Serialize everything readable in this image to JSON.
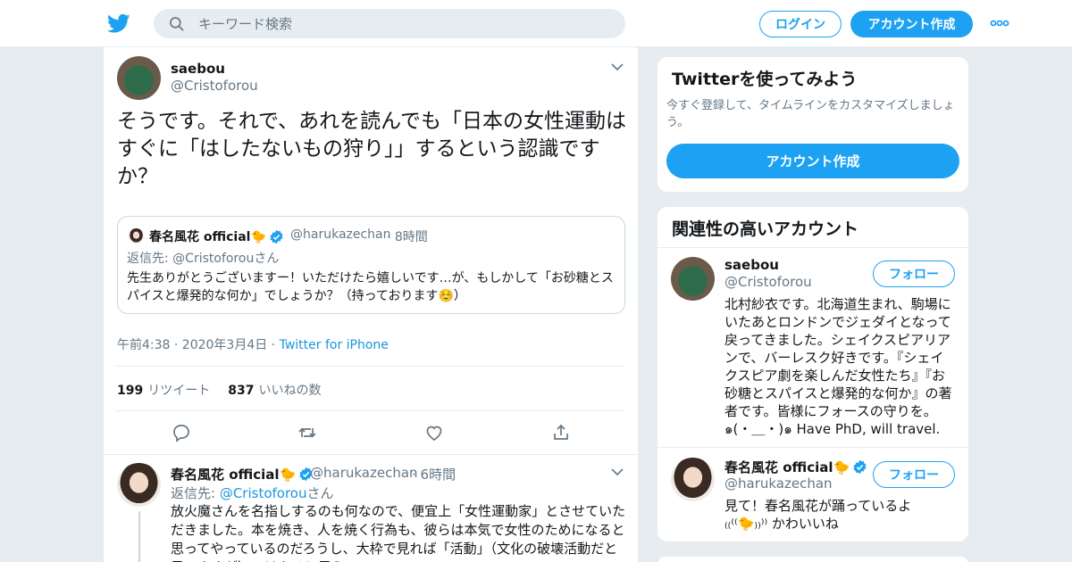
{
  "header": {
    "search_placeholder": "キーワード検索",
    "login_label": "ログイン",
    "signup_label": "アカウント作成"
  },
  "tweet": {
    "display_name": "saebou",
    "handle": "@Cristoforou",
    "text": "そうです。それで、あれを読んでも「日本の女性運動はすぐに「はしたないもの狩り」」するという認識ですか？",
    "quote": {
      "display_name": "春名風花 official🐤",
      "handle": "@harukazechan",
      "time": "· 8時間",
      "reply_prefix": "返信先: ",
      "reply_handle": "@Cristoforou",
      "reply_suffix": "さん",
      "text": "先生ありがとうございますー！いただけたら嬉しいです…が、もしかして「お砂糖とスパイスと爆発的な何か」でしょうか？（持っております☺️）"
    },
    "timestamp": "午前4:38 · 2020年3月4日 · ",
    "source": "Twitter for iPhone",
    "retweet_count": "199",
    "retweet_label": "リツイート",
    "like_count": "837",
    "like_label": "いいねの数"
  },
  "reply": {
    "display_name": "春名風花 official🐤",
    "handle": "@harukazechan",
    "time": "· 6時間",
    "reply_prefix": "返信先: ",
    "reply_handle": "@Cristoforou",
    "reply_suffix": "さん",
    "text": "放火魔さんを名指しするのも何なので、便宜上「女性運動家」とさせていただきました。本を焼き、人を焼く行為も、彼らは本気で女性のためになると思ってやっているのだろうし、大枠で見れば「活動」（文化の破壊活動だと思いますが）ではあると思うので"
  },
  "sidebar": {
    "signup_card": {
      "title": "Twitterを使ってみよう",
      "text": "今すぐ登録して、タイムラインをカスタマイズしましょう。",
      "button_label": "アカウント作成"
    },
    "related": {
      "title": "関連性の高いアカウント",
      "follow_label": "フォロー",
      "accounts": [
        {
          "display_name": "saebou",
          "handle": "@Cristoforou",
          "bio": "北村紗衣です。北海道生まれ、駒場にいたあとロンドンでジェダイとなって戻ってきました。シェイクスピアリアンで、バーレスク好きです。『シェイクスピア劇を楽しんだ女性たち』『お砂糖とスパイスと爆発的な何か』の著者です。皆様にフォースの守りを。๑(・＿・)๑ Have PhD, will travel."
        },
        {
          "display_name": "春名風花 official🐤",
          "handle": "@harukazechan",
          "bio": "見て！春名風花が踊っているよ ₍₍⁽⁽🐤₎₎⁾⁾ かわいいね"
        }
      ]
    }
  },
  "colors": {
    "brand": "#1da1f2",
    "link": "#1b95e0",
    "secondary_text": "#657786"
  }
}
